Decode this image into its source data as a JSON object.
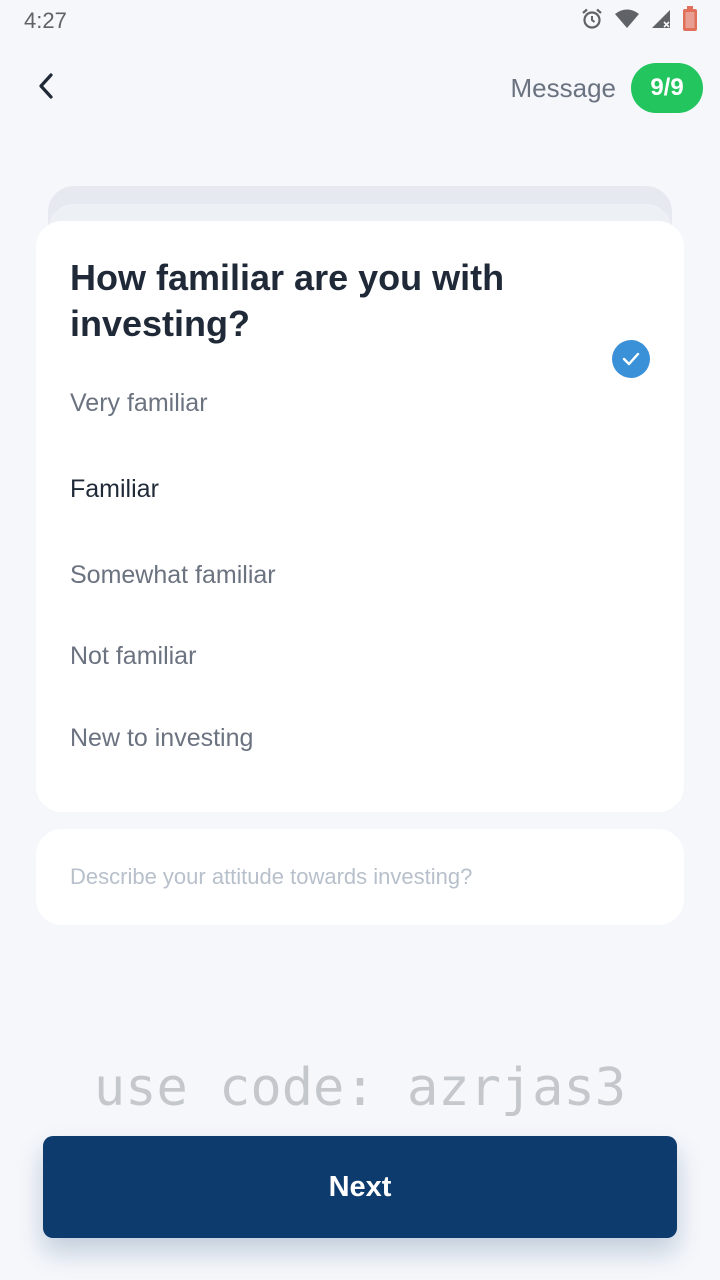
{
  "status_bar": {
    "time": "4:27",
    "icons": [
      "alarm-icon",
      "wifi-icon",
      "signal-icon",
      "battery-icon"
    ]
  },
  "header": {
    "title": "Message",
    "step_badge": "9/9"
  },
  "question": {
    "title": "How familiar are you with investing?",
    "options": [
      {
        "label": "Very familiar",
        "selected": false
      },
      {
        "label": "Familiar",
        "selected": true
      },
      {
        "label": "Somewhat familiar",
        "selected": false
      },
      {
        "label": "Not familiar",
        "selected": false
      },
      {
        "label": "New to investing",
        "selected": false
      }
    ]
  },
  "attitude": {
    "placeholder": "Describe your attitude towards investing?"
  },
  "promo": {
    "text": "use code: azrjas3"
  },
  "footer": {
    "next_label": "Next"
  },
  "colors": {
    "background": "#f5f7fb",
    "badge": "#22c55e",
    "check": "#3b91d8",
    "primary_button": "#0d3b6e"
  }
}
